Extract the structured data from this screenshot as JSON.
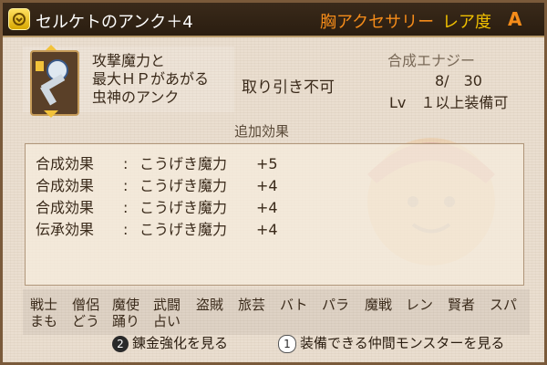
{
  "title": "セルケトのアンク＋4",
  "category": "胸アクセサリー",
  "rarity_label": "レア度",
  "rarity": "A",
  "description": [
    "攻撃魔力と",
    "最大ＨＰがあがる",
    "虫神のアンク"
  ],
  "trade": "取り引き不可",
  "synthesis": {
    "label": "合成エナジー",
    "value": "8/　30"
  },
  "level_requirement": "Lv　１以上装備可",
  "extra_effects_title": "追加効果",
  "effects": [
    {
      "name": "合成効果",
      "stat": "こうげき魔力",
      "value": "+5"
    },
    {
      "name": "合成効果",
      "stat": "こうげき魔力",
      "value": "+4"
    },
    {
      "name": "合成効果",
      "stat": "こうげき魔力",
      "value": "+4"
    },
    {
      "name": "伝承効果",
      "stat": "こうげき魔力",
      "value": "+4"
    }
  ],
  "jobs_row1": [
    "戦士",
    "僧侶",
    "魔使",
    "武闘",
    "盗賊",
    "旅芸",
    "バト",
    "パラ",
    "魔戦",
    "レン",
    "賢者",
    "スパ"
  ],
  "jobs_row2": [
    "まも",
    "どう",
    "踊り",
    "占い"
  ],
  "buttons": {
    "alchemy": {
      "key": "2",
      "label": "錬金強化を見る"
    },
    "allies": {
      "key": "1",
      "label": "装備できる仲間モンスターを見る"
    }
  },
  "icons": {
    "title": "accessory-badge-icon",
    "item": "ankh-icon"
  },
  "colors": {
    "title_text": "#ffffff",
    "category": "#f58c1a",
    "rarity_label": "#f0c000"
  }
}
